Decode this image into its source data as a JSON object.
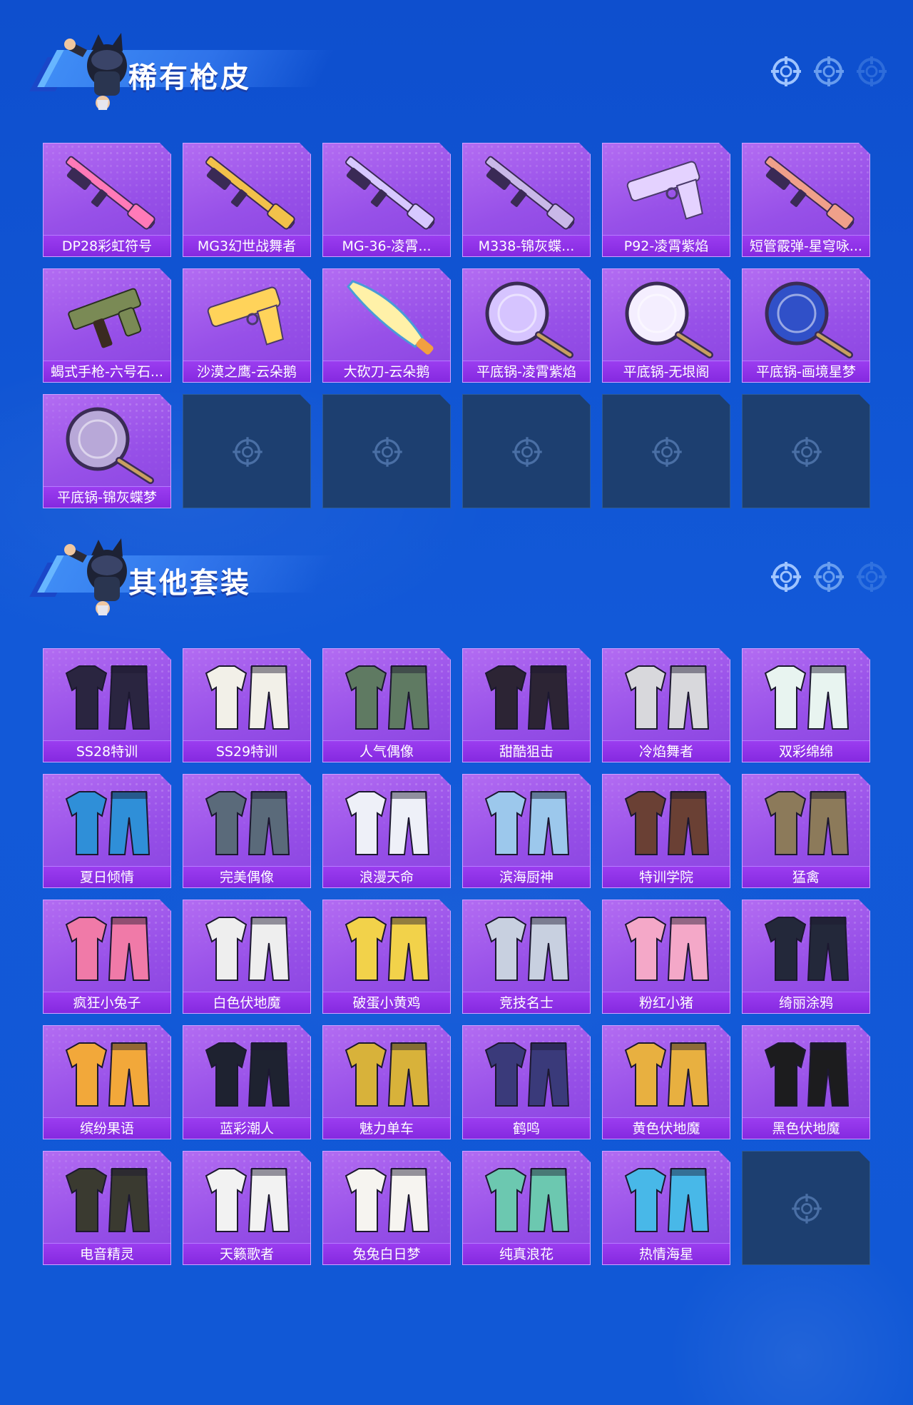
{
  "sections": [
    {
      "title": "稀有枪皮",
      "items": [
        {
          "label": "DP28彩虹符号",
          "art": "rifle",
          "color": "#ff7ab8"
        },
        {
          "label": "MG3幻世战舞者",
          "art": "rifle",
          "color": "#f2c14a"
        },
        {
          "label": "MG-36-凌霄...",
          "art": "rifle",
          "color": "#d7c8ff"
        },
        {
          "label": "M338-锦灰蝶...",
          "art": "rifle",
          "color": "#c9b8e8"
        },
        {
          "label": "P92-凌霄紫焰",
          "art": "pistol",
          "color": "#e4d2ff"
        },
        {
          "label": "短管霰弹-星穹咏...",
          "art": "rifle",
          "color": "#f0a08a"
        },
        {
          "label": "蝎式手枪-六号石...",
          "art": "smg",
          "color": "#7a8a55"
        },
        {
          "label": "沙漠之鹰-云朵鹅",
          "art": "pistol",
          "color": "#ffd35a"
        },
        {
          "label": "大砍刀-云朵鹅",
          "art": "machete",
          "color": "#fff1a8"
        },
        {
          "label": "平底锅-凌霄紫焰",
          "art": "pan",
          "color": "#d6c4ff"
        },
        {
          "label": "平底锅-无垠阁",
          "art": "pan",
          "color": "#f4eeff"
        },
        {
          "label": "平底锅-画境星梦",
          "art": "pan",
          "color": "#3050c8"
        },
        {
          "label": "平底锅-锦灰蝶梦",
          "art": "pan",
          "color": "#b8a8d8"
        },
        {
          "label": "",
          "art": "empty"
        },
        {
          "label": "",
          "art": "empty"
        },
        {
          "label": "",
          "art": "empty"
        },
        {
          "label": "",
          "art": "empty"
        },
        {
          "label": "",
          "art": "empty"
        }
      ]
    },
    {
      "title": "其他套装",
      "items": [
        {
          "label": "SS28特训",
          "art": "outfit",
          "color": "#2a2540"
        },
        {
          "label": "SS29特训",
          "art": "outfit",
          "color": "#f2f0e8"
        },
        {
          "label": "人气偶像",
          "art": "outfit",
          "color": "#5f7a62"
        },
        {
          "label": "甜酷狙击",
          "art": "outfit",
          "color": "#2c2434"
        },
        {
          "label": "冷焰舞者",
          "art": "outfit",
          "color": "#d8d8dc"
        },
        {
          "label": "双彩绵绵",
          "art": "outfit",
          "color": "#e8f4f0"
        },
        {
          "label": "夏日倾情",
          "art": "outfit",
          "color": "#2f8fd8"
        },
        {
          "label": "完美偶像",
          "art": "outfit",
          "color": "#5a6a7a"
        },
        {
          "label": "浪漫天命",
          "art": "outfit",
          "color": "#eef0f8"
        },
        {
          "label": "滨海厨神",
          "art": "outfit",
          "color": "#9cc8ec"
        },
        {
          "label": "特训学院",
          "art": "outfit",
          "color": "#6a4034"
        },
        {
          "label": "猛禽",
          "art": "outfit",
          "color": "#8c7a5a"
        },
        {
          "label": "疯狂小兔子",
          "art": "outfit",
          "color": "#f07aa8"
        },
        {
          "label": "白色伏地魔",
          "art": "outfit",
          "color": "#eeeeee"
        },
        {
          "label": "破蛋小黄鸡",
          "art": "outfit",
          "color": "#f2d24a"
        },
        {
          "label": "竞技名士",
          "art": "outfit",
          "color": "#c8d0e0"
        },
        {
          "label": "粉红小猪",
          "art": "outfit",
          "color": "#f4a8c8"
        },
        {
          "label": "绮丽涂鸦",
          "art": "outfit",
          "color": "#23283a"
        },
        {
          "label": "缤纷果语",
          "art": "outfit",
          "color": "#f2a83a"
        },
        {
          "label": "蓝彩潮人",
          "art": "outfit",
          "color": "#1e2230"
        },
        {
          "label": "魅力单车",
          "art": "outfit",
          "color": "#d8b23a"
        },
        {
          "label": "鹤鸣",
          "art": "outfit",
          "color": "#3a3a7a"
        },
        {
          "label": "黄色伏地魔",
          "art": "outfit",
          "color": "#e8b040"
        },
        {
          "label": "黑色伏地魔",
          "art": "outfit",
          "color": "#1c1c1e"
        },
        {
          "label": "电音精灵",
          "art": "outfit",
          "color": "#3a3a30"
        },
        {
          "label": "天籁歌者",
          "art": "outfit",
          "color": "#f2f2f2"
        },
        {
          "label": "兔兔白日梦",
          "art": "outfit",
          "color": "#f6f4f0"
        },
        {
          "label": "纯真浪花",
          "art": "outfit",
          "color": "#6cc8b0"
        },
        {
          "label": "热情海星",
          "art": "outfit",
          "color": "#48b8e8"
        },
        {
          "label": "",
          "art": "empty"
        }
      ]
    }
  ]
}
